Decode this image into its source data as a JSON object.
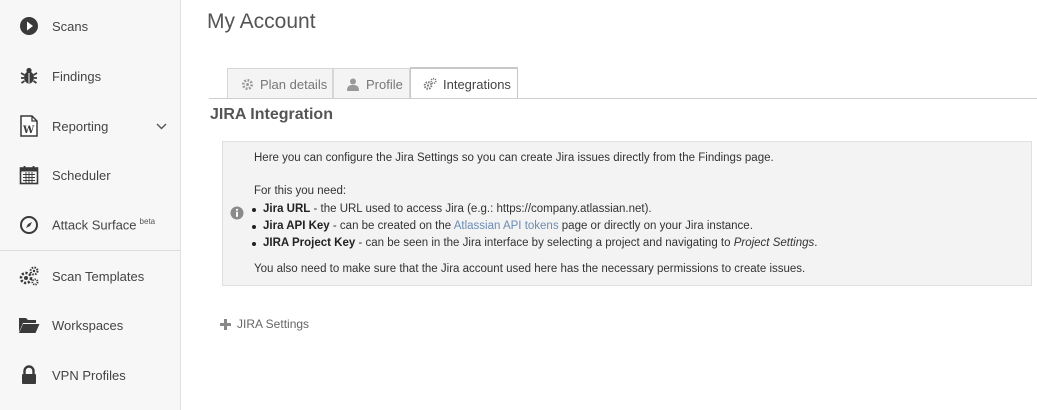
{
  "sidebar": {
    "items": [
      {
        "label": "Scans",
        "icon": "play-circle-icon"
      },
      {
        "label": "Findings",
        "icon": "bug-icon"
      },
      {
        "label": "Reporting",
        "icon": "word-document-icon"
      },
      {
        "label": "Scheduler",
        "icon": "calendar-icon"
      },
      {
        "label": "Attack Surface",
        "badge": "beta",
        "icon": "compass-icon"
      },
      {
        "label": "Scan Templates",
        "icon": "gears-icon"
      },
      {
        "label": "Workspaces",
        "icon": "folder-open-icon"
      },
      {
        "label": "VPN Profiles",
        "icon": "lock-icon"
      }
    ]
  },
  "page": {
    "title": "My Account"
  },
  "tabs": [
    {
      "label": "Plan details",
      "icon": "gear-icon"
    },
    {
      "label": "Profile",
      "icon": "user-icon"
    },
    {
      "label": "Integrations",
      "icon": "gears-icon",
      "active": true
    }
  ],
  "section": {
    "title": "JIRA Integration"
  },
  "info": {
    "intro": "Here you can configure the Jira Settings so you can create Jira issues directly from the Findings page.",
    "need_label": "For this you need:",
    "items": [
      {
        "bold": "Jira URL",
        "text": " - the URL used to access Jira (e.g.: https://company.atlassian.net)."
      },
      {
        "bold": "Jira API Key",
        "text_before": " - can be created on the ",
        "link": "Atlassian API tokens",
        "text_after": " page or directly on your Jira instance."
      },
      {
        "bold": "JIRA Project Key",
        "text_before": " - can be seen in the Jira interface by selecting a project and navigating to ",
        "italic": "Project Settings",
        "text_after": "."
      }
    ],
    "footer": "You also need to make sure that the Jira account used here has the necessary permissions to create issues."
  },
  "jira_settings": {
    "label": "JIRA Settings"
  },
  "colors": {
    "sidebar_bg": "#f7f7f7",
    "info_bg": "#f3f3f3",
    "link": "#6b8db5",
    "icon": "#3a3a3a"
  }
}
